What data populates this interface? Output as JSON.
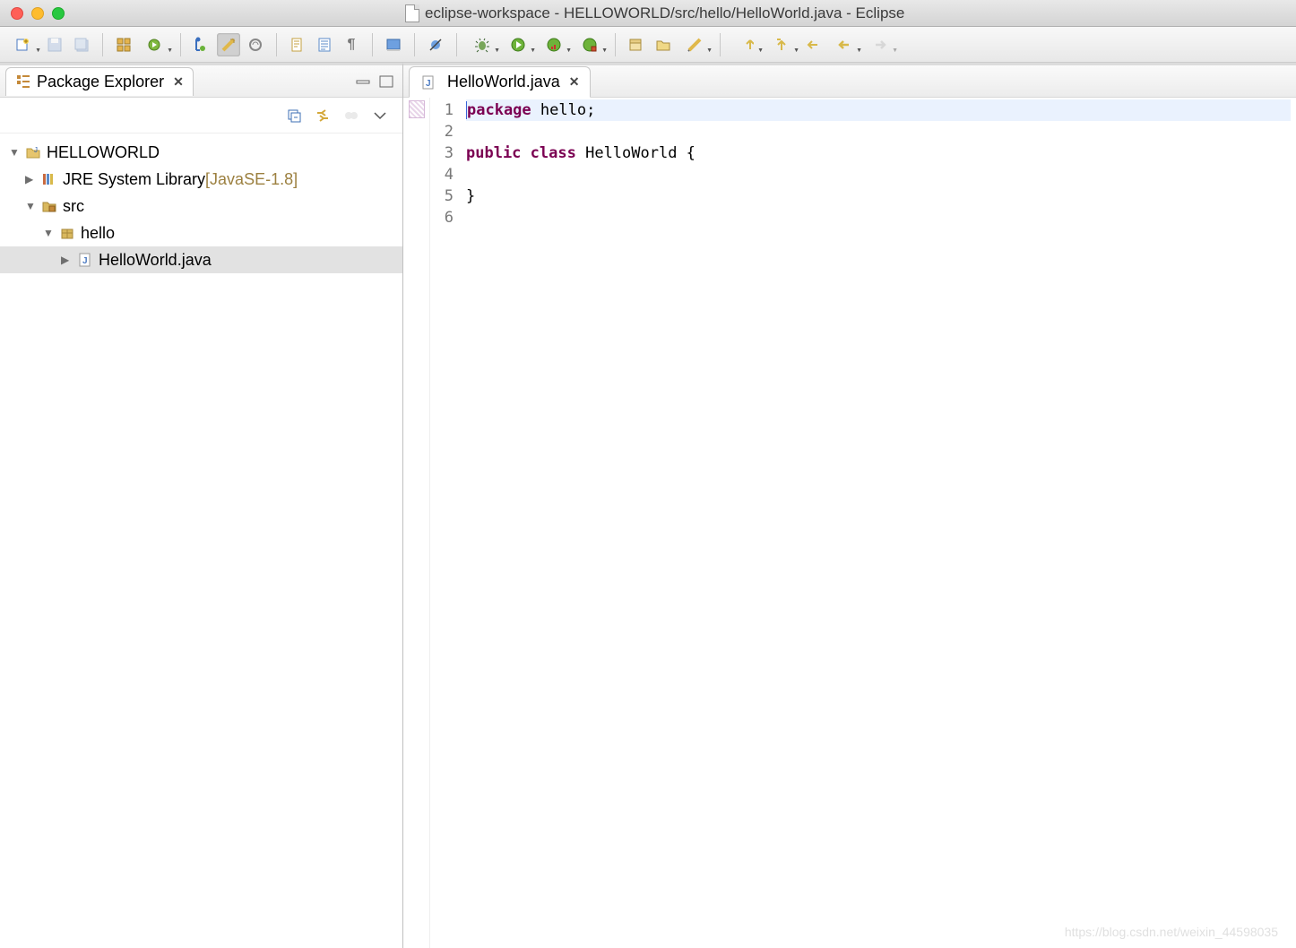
{
  "window": {
    "title": "eclipse-workspace - HELLOWORLD/src/hello/HelloWorld.java - Eclipse"
  },
  "explorer": {
    "title": "Package Explorer",
    "project": "HELLOWORLD",
    "jre_label": "JRE System Library ",
    "jre_annotation": "[JavaSE-1.8]",
    "src_folder": "src",
    "package_name": "hello",
    "file_name": "HelloWorld.java"
  },
  "editor": {
    "tab_title": "HelloWorld.java",
    "line_numbers": [
      "1",
      "2",
      "3",
      "4",
      "5",
      "6"
    ],
    "code": {
      "l1_kw": "package",
      "l1_rest": " hello;",
      "l3_kw1": "public",
      "l3_kw2": "class",
      "l3_rest": " HelloWorld {",
      "l5": "}"
    }
  },
  "watermark": "https://blog.csdn.net/weixin_44598035"
}
